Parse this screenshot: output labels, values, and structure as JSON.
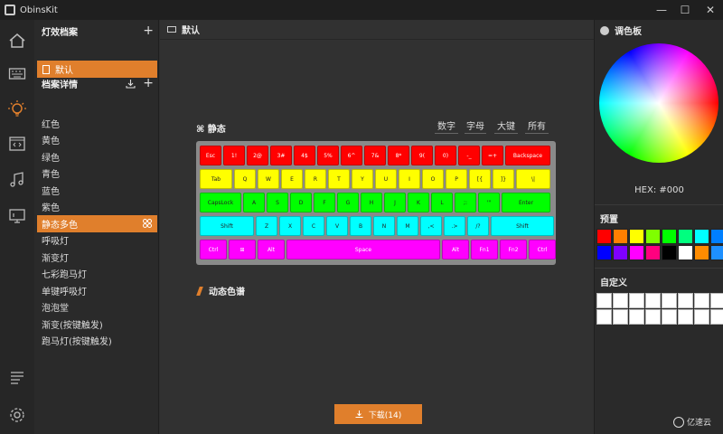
{
  "window": {
    "title": "ObinsKit",
    "minimize": "—",
    "maximize": "☐",
    "close": "✕"
  },
  "rail": {
    "items": [
      "home-icon",
      "keyboard-icon",
      "lightbulb-icon",
      "code-icon",
      "music-icon",
      "monitor-icon",
      "list-icon",
      "settings-icon"
    ]
  },
  "left": {
    "profiles_title": "灯效档案",
    "profile_active": "默认",
    "details_title": "档案详情",
    "add_label": "+",
    "effects": [
      "红色",
      "黄色",
      "绿色",
      "青色",
      "蓝色",
      "紫色",
      "静态多色",
      "呼吸灯",
      "渐变灯",
      "七彩跑马灯",
      "单键呼吸灯",
      "泡泡堂",
      "渐变(按键触发)",
      "跑马灯(按键触发)"
    ],
    "active_effect": "静态多色"
  },
  "center": {
    "title": "默认",
    "mode_label": "静态",
    "tabs": [
      "数字",
      "字母",
      "大键",
      "所有"
    ],
    "dyn_label": "动态色谱",
    "download_label": "下载(14)",
    "keyboard": {
      "row1": [
        "Esc",
        "1!",
        "2@",
        "3#",
        "4$",
        "5%",
        "6^",
        "7&",
        "8*",
        "9(",
        "0)",
        "-_",
        "=+",
        "Backspace"
      ],
      "row2": [
        "Tab",
        "Q",
        "W",
        "E",
        "R",
        "T",
        "Y",
        "U",
        "I",
        "O",
        "P",
        "[{",
        "]}",
        "\\|"
      ],
      "row3": [
        "CapsLock",
        "A",
        "S",
        "D",
        "F",
        "G",
        "H",
        "J",
        "K",
        "L",
        ";:",
        "'\"",
        "Enter"
      ],
      "row4": [
        "Shift",
        "Z",
        "X",
        "C",
        "V",
        "B",
        "N",
        "M",
        ",<",
        ".>",
        "/?",
        "Shift"
      ],
      "row5": [
        "Ctrl",
        "⊞",
        "Alt",
        "Space",
        "Alt",
        "Fn1",
        "Fn2",
        "Ctrl"
      ]
    }
  },
  "right": {
    "palette_title": "调色板",
    "hex_label": "HEX: #000",
    "preset_title": "预置",
    "custom_title": "自定义",
    "preset_colors": [
      "#ff0000",
      "#ff7f00",
      "#ffff00",
      "#7fff00",
      "#00ff00",
      "#00ff7f",
      "#00ffff",
      "#007fff",
      "#0000ff",
      "#7f00ff",
      "#ff00ff",
      "#ff007f",
      "#000000",
      "#ffffff",
      "#ff8c00",
      "#1e90ff"
    ]
  },
  "watermark": "亿速云"
}
